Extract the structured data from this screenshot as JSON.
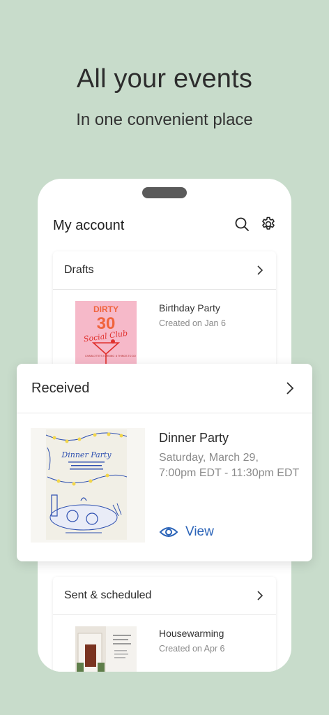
{
  "hero": {
    "title": "All your events",
    "subtitle": "In one convenient place"
  },
  "app": {
    "account_title": "My account",
    "icons": [
      "search-icon",
      "gear-icon"
    ]
  },
  "drafts": {
    "label": "Drafts",
    "event": {
      "title": "Birthday Party",
      "meta": "Created on Jan 6",
      "thumb": {
        "line1": "DIRTY",
        "line2": "30",
        "line3": "Social Club",
        "left_note": "CHARLOTTE'S TURNING",
        "right_note": "8 THINGS TO DO"
      }
    }
  },
  "received": {
    "label": "Received",
    "event": {
      "title": "Dinner Party",
      "date": "Saturday, March 29,",
      "time": "7:00pm EDT - 11:30pm EDT",
      "view_label": "View",
      "thumb": {
        "script_title": "Dinner Party"
      }
    }
  },
  "sent": {
    "label": "Sent & scheduled",
    "event": {
      "title": "Housewarming",
      "meta": "Created on Apr 6"
    }
  },
  "colors": {
    "background": "#c8dccb",
    "accent": "#2a63b8",
    "birthday_pink": "#f6b9c9",
    "birthday_orange": "#f0643d"
  }
}
